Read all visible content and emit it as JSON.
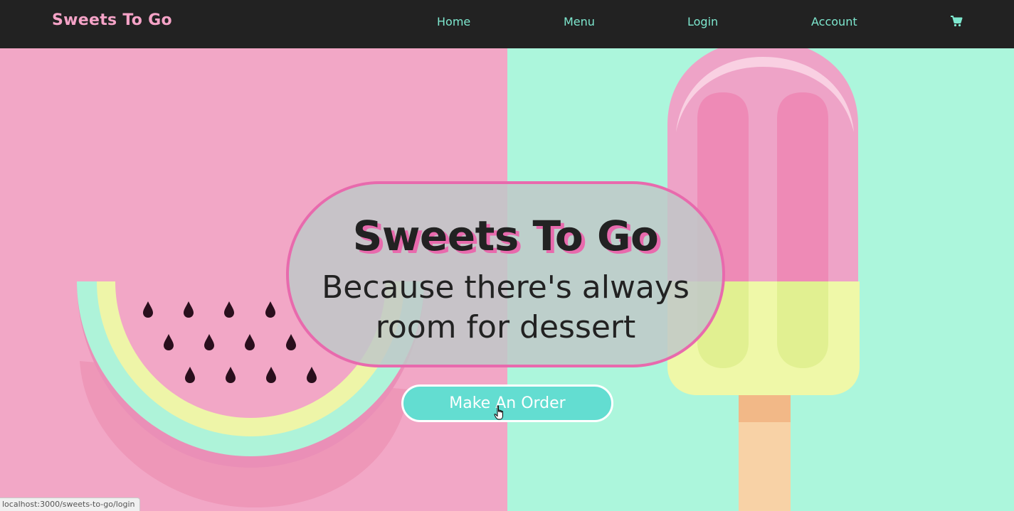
{
  "navbar": {
    "brand": "Sweets To Go",
    "links": [
      {
        "label": "Home"
      },
      {
        "label": "Menu"
      },
      {
        "label": "Login"
      },
      {
        "label": "Account"
      }
    ],
    "cart_icon": "shopping-cart-icon"
  },
  "hero": {
    "title": "Sweets To Go",
    "subtitle_line1": "Because there's always",
    "subtitle_line2": "room for dessert",
    "cta_label": "Make An Order"
  },
  "status_bar": {
    "url": "localhost:3000/sweets-to-go/login"
  },
  "colors": {
    "navbar_bg": "#222222",
    "brand": "#f5a3c7",
    "nav_link": "#7ee8cf",
    "hero_left": "#f2a7c6",
    "hero_right": "#acf6dc",
    "accent_pink": "#e86aad",
    "cta_bg": "#63ddd1"
  }
}
